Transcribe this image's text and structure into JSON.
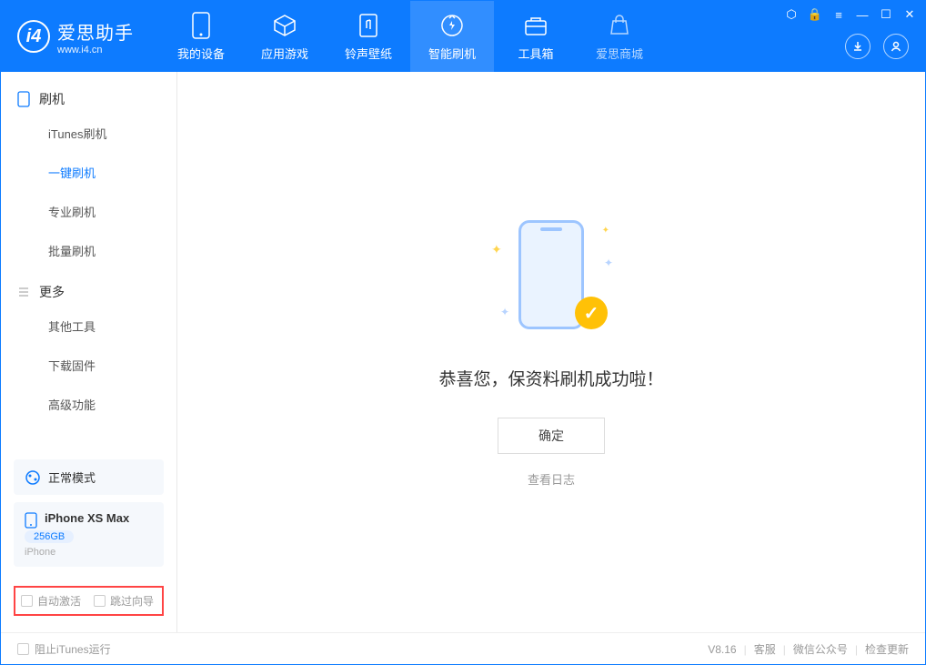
{
  "logo": {
    "cn": "爱思助手",
    "en": "www.i4.cn"
  },
  "nav": [
    {
      "label": "我的设备",
      "icon": "device"
    },
    {
      "label": "应用游戏",
      "icon": "apps"
    },
    {
      "label": "铃声壁纸",
      "icon": "ringtone"
    },
    {
      "label": "智能刷机",
      "icon": "flash",
      "active": true
    },
    {
      "label": "工具箱",
      "icon": "toolbox"
    },
    {
      "label": "爱思商城",
      "icon": "store",
      "dim": true
    }
  ],
  "sidebar": {
    "section1": {
      "title": "刷机",
      "items": [
        "iTunes刷机",
        "一键刷机",
        "专业刷机",
        "批量刷机"
      ],
      "activeIndex": 1
    },
    "section2": {
      "title": "更多",
      "items": [
        "其他工具",
        "下载固件",
        "高级功能"
      ]
    }
  },
  "device": {
    "mode": "正常模式",
    "name": "iPhone XS Max",
    "storage": "256GB",
    "type": "iPhone"
  },
  "checkboxes": {
    "auto_activate": "自动激活",
    "skip_wizard": "跳过向导"
  },
  "main": {
    "success_msg": "恭喜您，保资料刷机成功啦！",
    "ok_btn": "确定",
    "log_link": "查看日志"
  },
  "status": {
    "block_itunes": "阻止iTunes运行",
    "version": "V8.16",
    "links": [
      "客服",
      "微信公众号",
      "检查更新"
    ]
  }
}
